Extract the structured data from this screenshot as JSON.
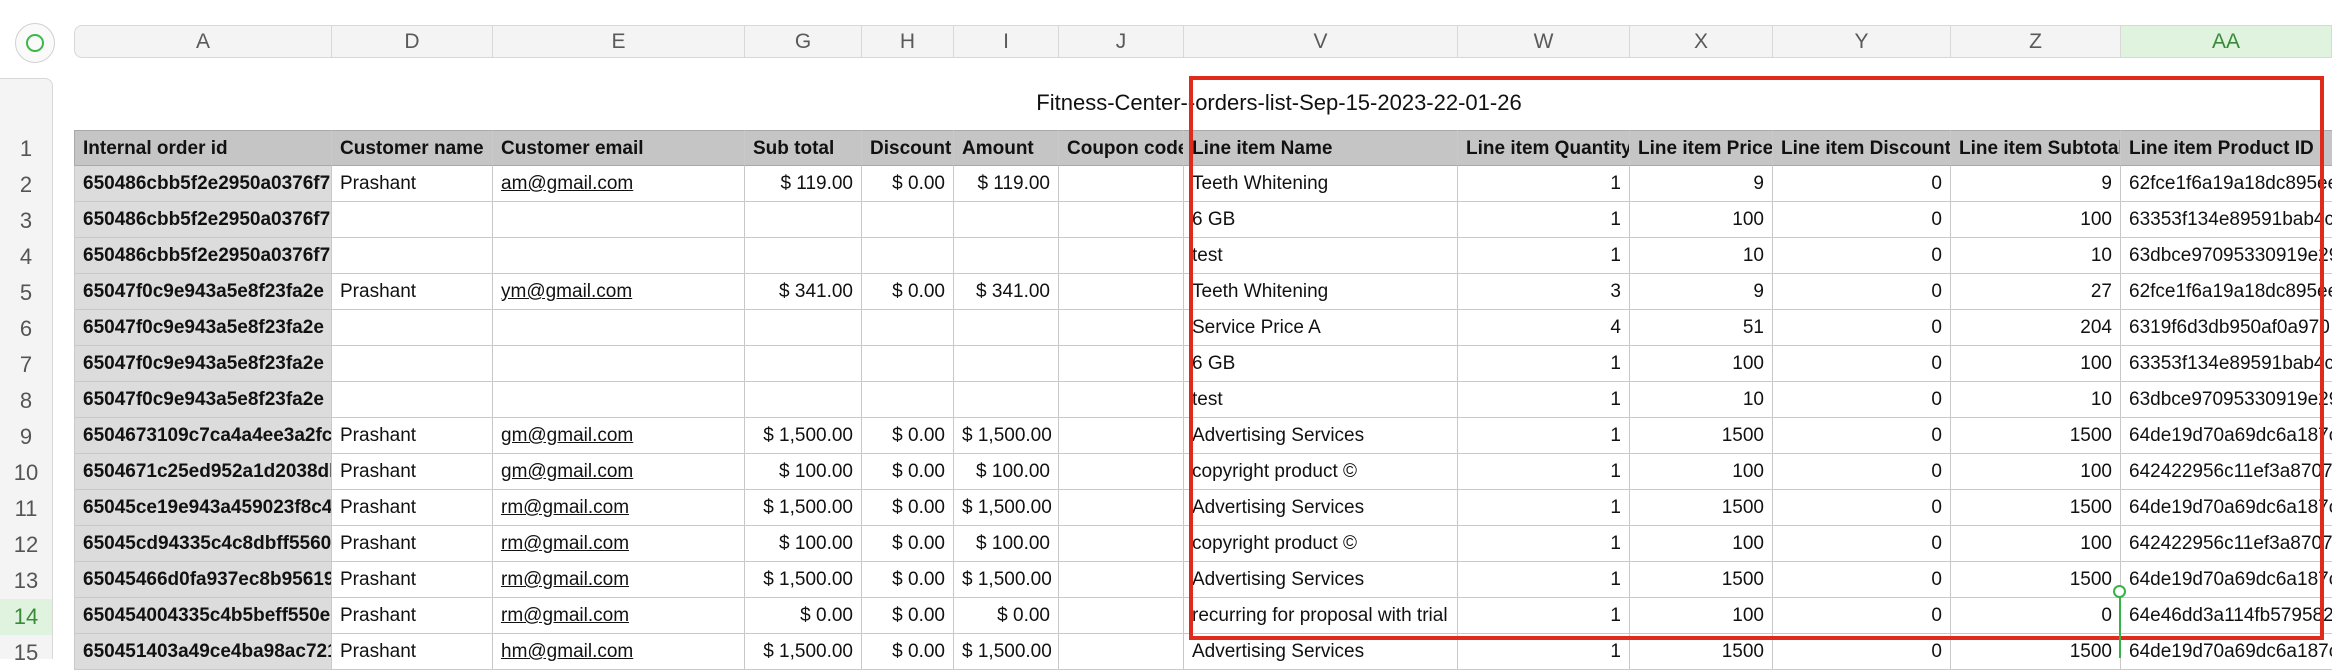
{
  "toolbar": {
    "add_icon": "add-circle-icon",
    "accent": "#3cb84a"
  },
  "column_headers": [
    "A",
    "D",
    "E",
    "G",
    "H",
    "I",
    "J",
    "V",
    "W",
    "X",
    "Y",
    "Z",
    "AA"
  ],
  "active_column": "AA",
  "row_numbers": [
    "1",
    "2",
    "3",
    "4",
    "5",
    "6",
    "7",
    "8",
    "9",
    "10",
    "11",
    "12",
    "13",
    "14",
    "15"
  ],
  "active_row": "14",
  "sheet_title": "Fitness-Center--orders-list-Sep-15-2023-22-01-26",
  "table_headers": [
    "Internal order id",
    "Customer name",
    "Customer email",
    "Sub total",
    "Discount",
    "Amount",
    "Coupon code",
    "Line item Name",
    "Line item Quantity",
    "Line item Price",
    "Line item Discount",
    "Line item Subtotal",
    "Line item Product ID"
  ],
  "rows": [
    [
      "650486cbb5f2e2950a0376f7",
      "Prashant",
      "am@gmail.com",
      "$ 119.00",
      "$ 0.00",
      "$ 119.00",
      "",
      "Teeth Whitening",
      "1",
      "9",
      "0",
      "9",
      "62fce1f6a19a18dc895ee"
    ],
    [
      "650486cbb5f2e2950a0376f7",
      "",
      "",
      "",
      "",
      "",
      "",
      "6 GB",
      "1",
      "100",
      "0",
      "100",
      "63353f134e89591bab4c"
    ],
    [
      "650486cbb5f2e2950a0376f7",
      "",
      "",
      "",
      "",
      "",
      "",
      "test",
      "1",
      "10",
      "0",
      "10",
      "63dbce97095330919e29"
    ],
    [
      "65047f0c9e943a5e8f23fa2e",
      "Prashant",
      "ym@gmail.com",
      "$ 341.00",
      "$ 0.00",
      "$ 341.00",
      "",
      "Teeth Whitening",
      "3",
      "9",
      "0",
      "27",
      "62fce1f6a19a18dc895ee"
    ],
    [
      "65047f0c9e943a5e8f23fa2e",
      "",
      "",
      "",
      "",
      "",
      "",
      "Service Price A",
      "4",
      "51",
      "0",
      "204",
      "6319f6d3db950af0a970"
    ],
    [
      "65047f0c9e943a5e8f23fa2e",
      "",
      "",
      "",
      "",
      "",
      "",
      "6 GB",
      "1",
      "100",
      "0",
      "100",
      "63353f134e89591bab4c"
    ],
    [
      "65047f0c9e943a5e8f23fa2e",
      "",
      "",
      "",
      "",
      "",
      "",
      "test",
      "1",
      "10",
      "0",
      "10",
      "63dbce97095330919e29"
    ],
    [
      "6504673109c7ca4a4ee3a2fc",
      "Prashant",
      "gm@gmail.com",
      "$ 1,500.00",
      "$ 0.00",
      "$ 1,500.00",
      "",
      "Advertising Services",
      "1",
      "1500",
      "0",
      "1500",
      "64de19d70a69dc6a187c"
    ],
    [
      "6504671c25ed952a1d2038db",
      "Prashant",
      "gm@gmail.com",
      "$ 100.00",
      "$ 0.00",
      "$ 100.00",
      "",
      "copyright product ©",
      "1",
      "100",
      "0",
      "100",
      "642422956c11ef3a8707"
    ],
    [
      "65045ce19e943a459023f8c4",
      "Prashant",
      "rm@gmail.com",
      "$ 1,500.00",
      "$ 0.00",
      "$ 1,500.00",
      "",
      "Advertising Services",
      "1",
      "1500",
      "0",
      "1500",
      "64de19d70a69dc6a187c"
    ],
    [
      "65045cd94335c4c8dbff5560",
      "Prashant",
      "rm@gmail.com",
      "$ 100.00",
      "$ 0.00",
      "$ 100.00",
      "",
      "copyright product ©",
      "1",
      "100",
      "0",
      "100",
      "642422956c11ef3a8707"
    ],
    [
      "65045466d0fa937ec8b95619",
      "Prashant",
      "rm@gmail.com",
      "$ 1,500.00",
      "$ 0.00",
      "$ 1,500.00",
      "",
      "Advertising Services",
      "1",
      "1500",
      "0",
      "1500",
      "64de19d70a69dc6a187c"
    ],
    [
      "650454004335c4b5beff550e",
      "Prashant",
      "rm@gmail.com",
      "$ 0.00",
      "$ 0.00",
      "$ 0.00",
      "",
      "recurring for proposal with trial",
      "1",
      "100",
      "0",
      "0",
      "64e46dd3a114fb579582"
    ],
    [
      "650451403a49ce4ba98ac721",
      "Prashant",
      "hm@gmail.com",
      "$ 1,500.00",
      "$ 0.00",
      "$ 1,500.00",
      "",
      "Advertising Services",
      "1",
      "1500",
      "0",
      "1500",
      "64de19d70a69dc6a187c"
    ]
  ],
  "colors": {
    "selection_border": "#e02a1c",
    "active_cell": "#37b24a",
    "header_fill": "#c5c5c5"
  }
}
